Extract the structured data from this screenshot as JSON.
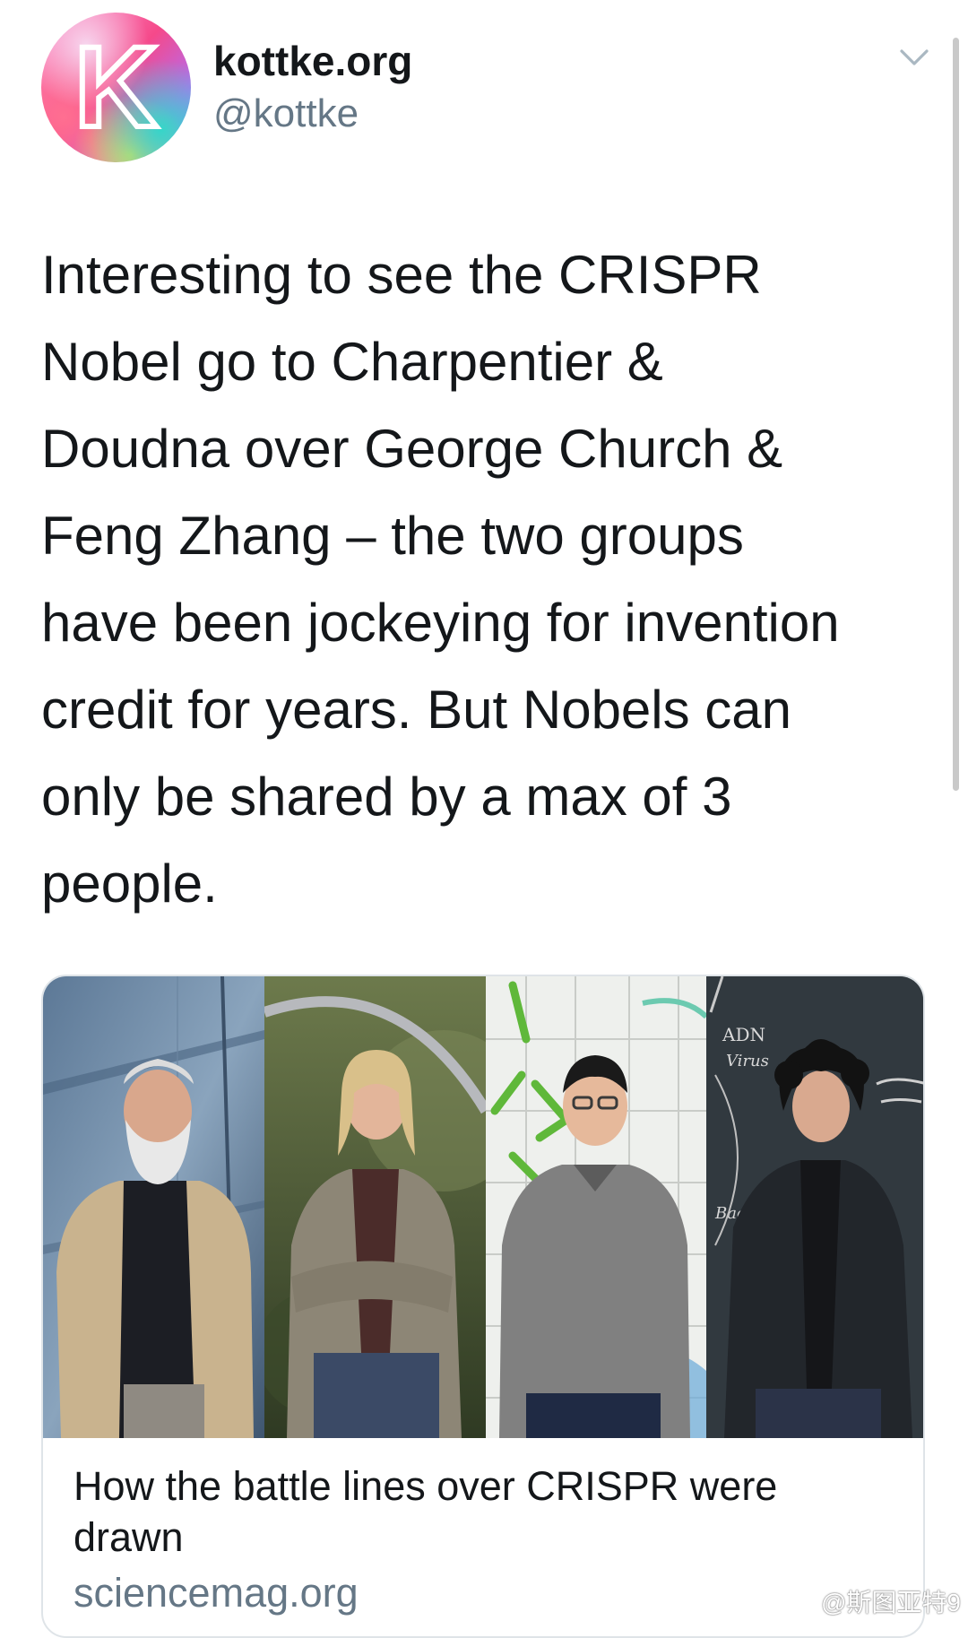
{
  "author": {
    "avatar_letter": "K",
    "name": "kottke.org",
    "handle": "@kottke"
  },
  "tweet": {
    "lines": [
      "Interesting to see the CRISPR",
      "Nobel go to Charpentier &",
      "Doudna over George Church &",
      "Feng Zhang – the two groups",
      "have been jockeying for invention",
      "credit for years. But Nobels can",
      "only be shared by a max of 3",
      "people."
    ]
  },
  "card": {
    "title_lines": [
      "How the battle lines over CRISPR were",
      "drawn"
    ],
    "domain": "sciencemag.org",
    "photo_board_text": [
      "ADN",
      "Virus",
      "Bact"
    ]
  },
  "watermark": {
    "text": "@斯图亚特9",
    "icon": "weibo-icon"
  },
  "icons": {
    "menu": "chevron-down-icon"
  },
  "colors": {
    "text": "#14171a",
    "secondary": "#657786",
    "border": "#dfe4e8"
  }
}
